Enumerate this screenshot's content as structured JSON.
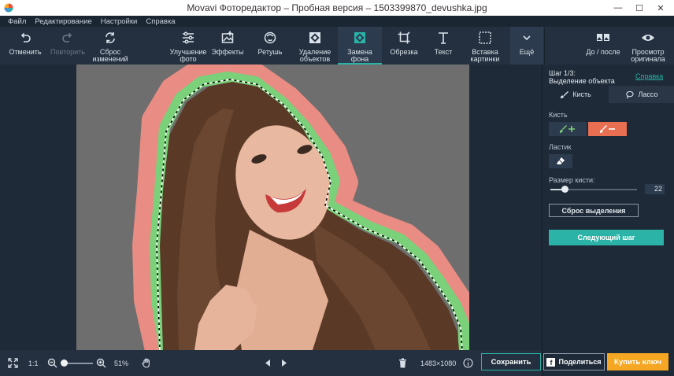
{
  "window": {
    "title": "Movavi Фоторедактор – Пробная версия – 1503399870_devushka.jpg",
    "minimize": "—",
    "maximize": "☐",
    "close": "✕"
  },
  "menu": [
    "Файл",
    "Редактирование",
    "Настройки",
    "Справка"
  ],
  "toolbar": {
    "undo": "Отменить",
    "redo": "Повторить",
    "reset_l1": "Сброс",
    "reset_l2": "изменений",
    "enhance_l1": "Улучшение",
    "enhance_l2": "фото",
    "effects": "Эффекты",
    "retouch": "Ретушь",
    "remove_l1": "Удаление",
    "remove_l2": "объектов",
    "bg_l1": "Замена",
    "bg_l2": "фона",
    "crop": "Обрезка",
    "text": "Текст",
    "insert_l1": "Вставка",
    "insert_l2": "картинки",
    "more": "Ещё",
    "before_after": "До / после",
    "preview_l1": "Просмотр",
    "preview_l2": "оригинала"
  },
  "panel": {
    "step_line1": "Шаг 1/3:",
    "step_line2": "Выделение объекта",
    "help": "Справка",
    "tab_brush": "Кисть",
    "tab_lasso": "Лассо",
    "brush_label": "Кисть",
    "eraser_label": "Ластик",
    "brush_size_label": "Размер кисти:",
    "brush_size_value": "22",
    "brush_size_fraction": 0.16,
    "reset_selection": "Сброс выделения",
    "next_step": "Следующий шаг"
  },
  "bottom": {
    "one_to_one": "1:1",
    "zoom_percent": "51%",
    "zoom_fraction": 0.08,
    "dimensions": "1483×1080",
    "save": "Сохранить",
    "share_icon": "f",
    "share": "Поделиться",
    "buy": "Купить ключ"
  },
  "colors": {
    "accent": "#2ab3a6",
    "remove_brush": "#e86f52",
    "buy": "#f5a623",
    "selection_green": "#7bd07a",
    "selection_red": "#e98c83"
  }
}
